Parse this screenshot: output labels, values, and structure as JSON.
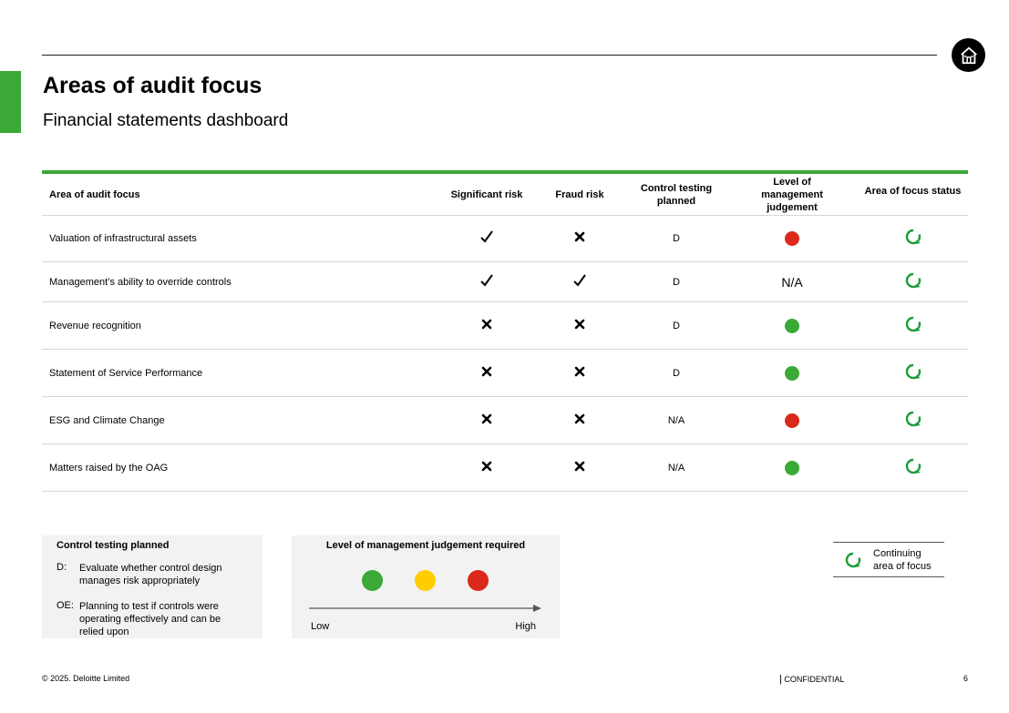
{
  "header": {
    "title": "Areas of audit focus",
    "subtitle": "Financial statements dashboard"
  },
  "table": {
    "columns": [
      "Area of audit focus",
      "Significant risk",
      "Fraud risk",
      "Control testing planned",
      "Level of management judgement",
      "Area of focus status"
    ],
    "rows": [
      {
        "area": "Valuation of infrastructural assets",
        "significant": "check",
        "fraud": "cross",
        "control": "D",
        "mgmt": "red",
        "status": "continuing"
      },
      {
        "area": "Management’s ability to override controls",
        "significant": "check",
        "fraud": "check",
        "control": "D",
        "mgmt": "N/A",
        "status": "continuing"
      },
      {
        "area": "Revenue recognition",
        "significant": "cross",
        "fraud": "cross",
        "control": "D",
        "mgmt": "green",
        "status": "continuing"
      },
      {
        "area": "Statement of Service Performance",
        "significant": "cross",
        "fraud": "cross",
        "control": "D",
        "mgmt": "green",
        "status": "continuing"
      },
      {
        "area": "ESG and Climate Change",
        "significant": "cross",
        "fraud": "cross",
        "control": "N/A",
        "mgmt": "red",
        "status": "continuing"
      },
      {
        "area": "Matters raised by the OAG",
        "significant": "cross",
        "fraud": "cross",
        "control": "N/A",
        "mgmt": "green",
        "status": "continuing"
      }
    ]
  },
  "legend_control": {
    "title": "Control testing planned",
    "items": [
      {
        "abbr": "D:",
        "desc": "Evaluate whether control design manages risk appropriately"
      },
      {
        "abbr": "OE:",
        "desc": "Planning to test if controls were operating effectively and can be relied upon"
      }
    ]
  },
  "legend_judgement": {
    "title": "Level of management judgement required",
    "low": "Low",
    "high": "High"
  },
  "legend_status": {
    "label": "Continuing area of focus"
  },
  "footer": {
    "copyright": "© 2025. Deloitte Limited",
    "confidential": "CONFIDENTIAL",
    "page": "6"
  },
  "colors": {
    "brand_green": "#3aa935",
    "status_green": "#3aa935",
    "status_yellow": "#ffcd00",
    "status_red": "#da291c",
    "icon_green": "#1e9c3c"
  }
}
